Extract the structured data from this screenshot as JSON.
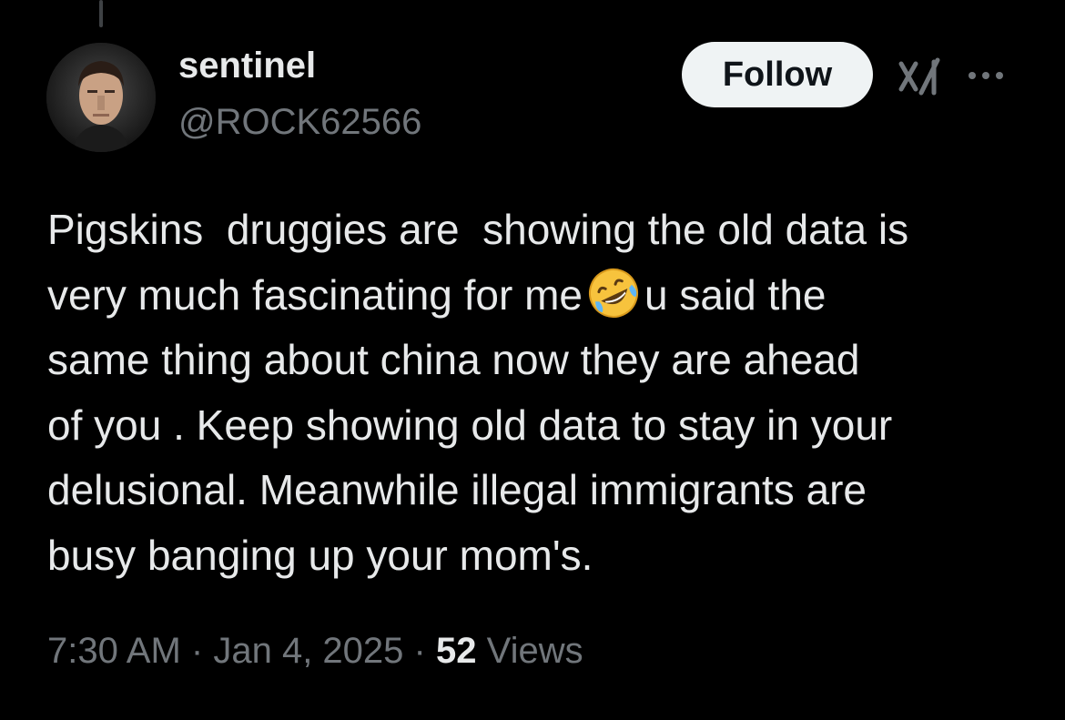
{
  "user": {
    "display_name": "sentinel",
    "handle": "@ROCK62566",
    "avatar_icon": "profile-photo-icon"
  },
  "actions": {
    "follow_label": "Follow",
    "grok_icon": "grok-icon",
    "more_icon": "more-options-icon"
  },
  "tweet": {
    "lines": [
      "Pigskins  druggies are  showing the old data is",
      "very much fascinating for me",
      "u said the",
      "same thing about china now they are ahead",
      "of you . Keep showing old data to stay in your",
      "delusional. Meanwhile illegal immigrants are",
      "busy banging up your mom's."
    ],
    "emoji": "rolling-on-the-floor-laughing-emoji"
  },
  "meta": {
    "time": "7:30 AM",
    "separator": "·",
    "date": "Jan 4, 2025",
    "views_count": "52",
    "views_label": "Views"
  },
  "colors": {
    "background": "#000000",
    "primary_text": "#e7e9ea",
    "secondary_text": "#71767b",
    "follow_button_bg": "#eff3f4",
    "follow_button_text": "#0f1419"
  }
}
